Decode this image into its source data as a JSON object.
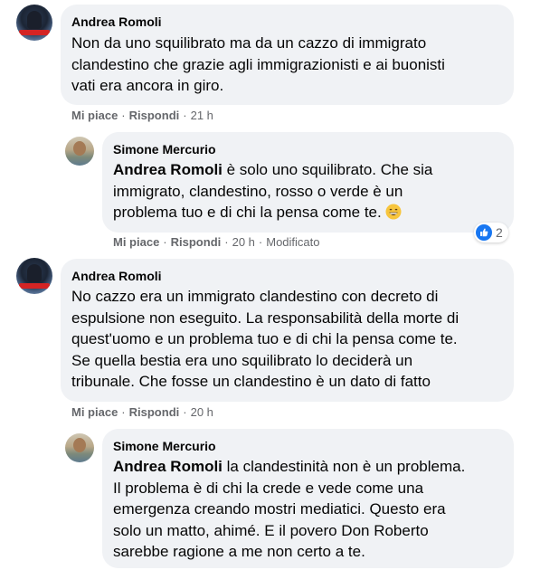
{
  "comments": [
    {
      "author": "Andrea Romoli",
      "lines": [
        "Non da uno squilibrato ma da un cazzo di immigrato",
        "clandestino che grazie agli immigrazionisti e ai buonisti",
        "vati era ancora in giro."
      ],
      "like": "Mi piace",
      "reply": "Rispondi",
      "time": "21 h"
    },
    {
      "author": "Simone Mercurio",
      "mention": "Andrea Romoli",
      "first_line_rest": " è solo uno squilibrato. Che sia",
      "lines": [
        "immigrato, clandestino, rosso o verde è un",
        "problema tuo e di chi la pensa come te."
      ],
      "emoji": "grinning-face-with-smiling-eyes",
      "like": "Mi piace",
      "reply": "Rispondi",
      "time": "20 h",
      "edited": "Modificato",
      "reaction_count": "2"
    },
    {
      "author": "Andrea Romoli",
      "lines": [
        "No cazzo era un immigrato clandestino con decreto di",
        "espulsione non eseguito. La responsabilità della morte di",
        "quest'uomo e un problema tuo e di chi la pensa come te.",
        "Se quella bestia era uno squilibrato lo deciderà un",
        "tribunale. Che fosse un clandestino è un dato di fatto"
      ],
      "like": "Mi piace",
      "reply": "Rispondi",
      "time": "20 h"
    },
    {
      "author": "Simone Mercurio",
      "mention": "Andrea Romoli",
      "first_line_rest": " la clandestinità non è un problema.",
      "lines": [
        "Il problema è di chi la crede e vede come una",
        "emergenza creando mostri mediatici. Questo era",
        "solo un matto, ahimé. E il povero Don Roberto",
        "sarebbe ragione a me non certo a te."
      ]
    }
  ],
  "separator": "·",
  "colors": {
    "bubble": "#f0f2f5",
    "meta": "#65676b",
    "like_blue": "#1877f2",
    "badge_red": "#d42424"
  }
}
